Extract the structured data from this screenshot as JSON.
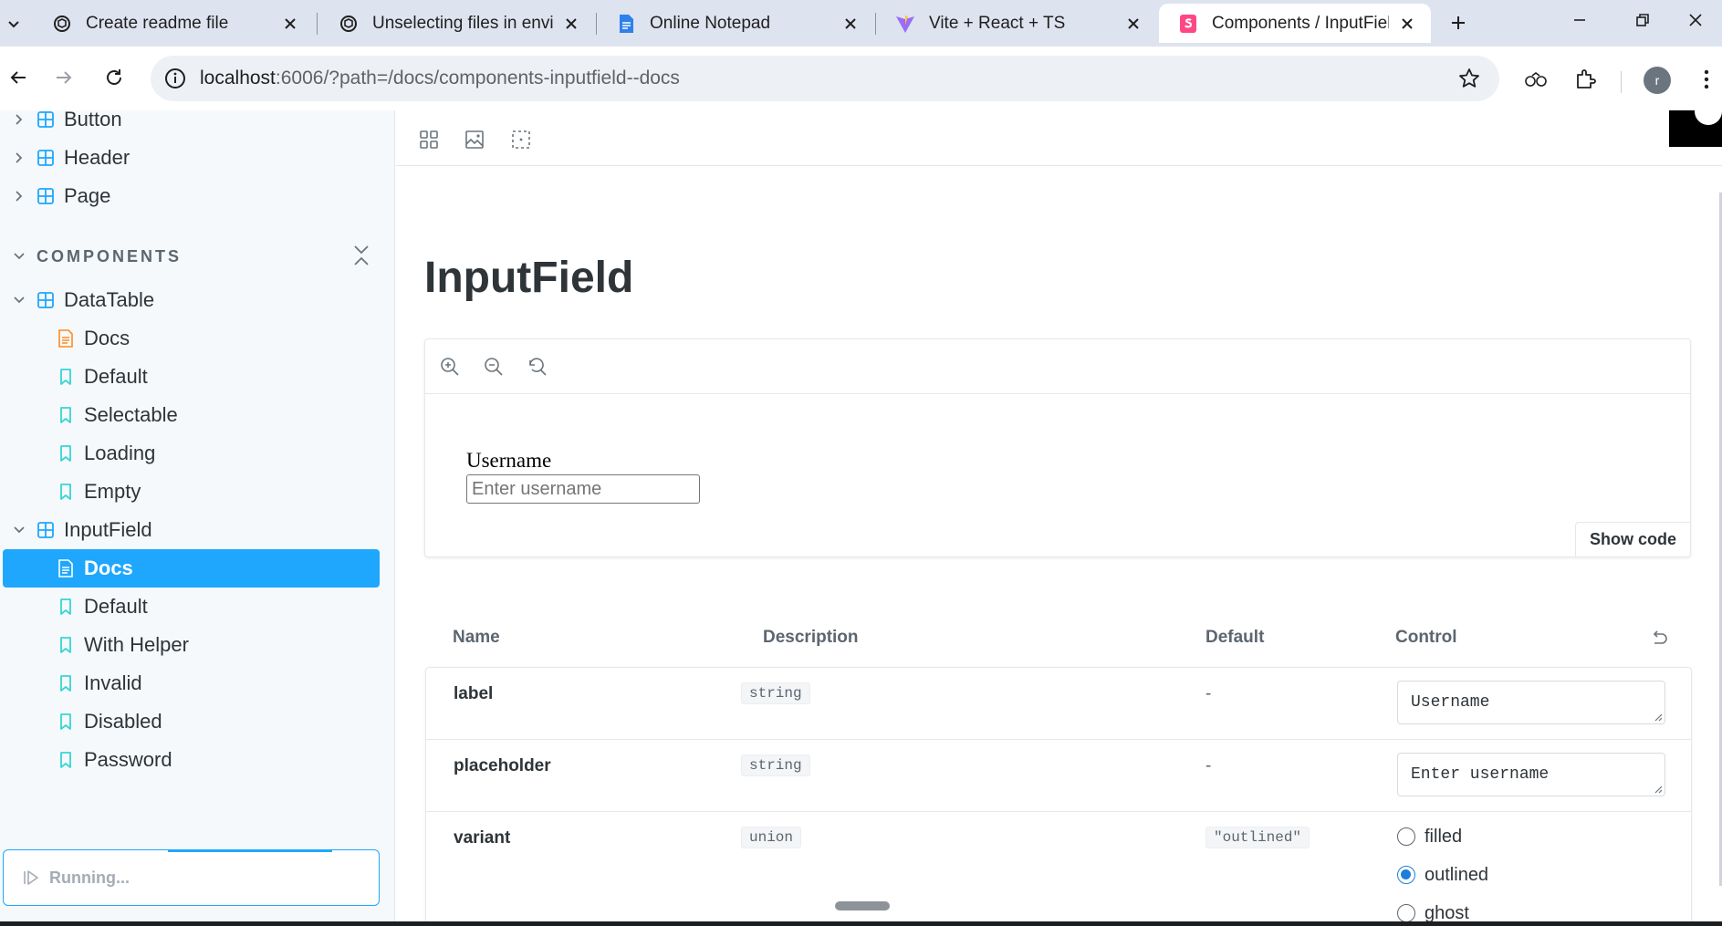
{
  "browser": {
    "tabs": [
      {
        "title": "Create readme file",
        "icon": "chatgpt-icon"
      },
      {
        "title": "Unselecting files in environment",
        "icon": "chatgpt-icon"
      },
      {
        "title": "Online Notepad",
        "icon": "document-icon"
      },
      {
        "title": "Vite + React + TS",
        "icon": "vite-icon"
      },
      {
        "title": "Components / InputField",
        "icon": "storybook-icon",
        "active": true
      }
    ],
    "url_host": "localhost",
    "url_rest": ":6006/?path=/docs/components-inputfield--docs",
    "avatar_initial": "r"
  },
  "sidebar": {
    "top_items": [
      {
        "label": "Button"
      },
      {
        "label": "Header"
      },
      {
        "label": "Page"
      }
    ],
    "section_title": "COMPONENTS",
    "datatable": {
      "label": "DataTable",
      "children": [
        "Docs",
        "Default",
        "Selectable",
        "Loading",
        "Empty"
      ]
    },
    "inputfield": {
      "label": "InputField",
      "children": [
        "Docs",
        "Default",
        "With Helper",
        "Invalid",
        "Disabled",
        "Password"
      ]
    },
    "running": "Running..."
  },
  "doc": {
    "title": "InputField",
    "story": {
      "label": "Username",
      "placeholder": "Enter username"
    },
    "show_code": "Show code"
  },
  "args_table": {
    "headers": {
      "name": "Name",
      "description": "Description",
      "default": "Default",
      "control": "Control"
    },
    "rows": [
      {
        "name": "label",
        "type": "string",
        "default": "-",
        "control_value": "Username"
      },
      {
        "name": "placeholder",
        "type": "string",
        "default": "-",
        "control_value": "Enter username"
      },
      {
        "name": "variant",
        "type": "union",
        "default": "\"outlined\"",
        "options": [
          "filled",
          "outlined",
          "ghost"
        ],
        "selected": "outlined"
      }
    ]
  },
  "colors": {
    "accent": "#1ea7fd",
    "tab_strip": "#dde3ef",
    "sidebar_bg": "#f6f9fc"
  }
}
